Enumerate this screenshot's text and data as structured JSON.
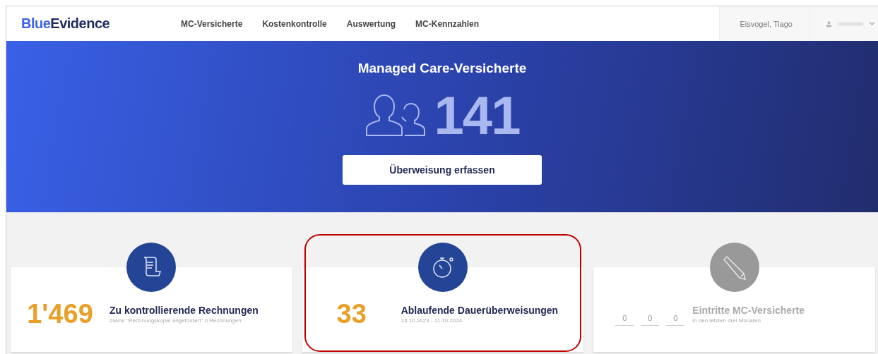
{
  "logo": [
    {
      "text": "Blue",
      "color": "#3d63e6"
    },
    {
      "text": "Evidence",
      "color": "#1f2b5e"
    }
  ],
  "nav": [
    {
      "label": "MC-Versicherte"
    },
    {
      "label": "Kostenkontrolle"
    },
    {
      "label": "Auswertung"
    },
    {
      "label": "MC-Kennzahlen"
    }
  ],
  "user": {
    "name": "Eisvogel, Tiago"
  },
  "hero": {
    "title": "Managed Care-Versicherte",
    "count": "141",
    "button": "Überweisung erfassen"
  },
  "cards": [
    {
      "kind": "number",
      "disabled": false,
      "highlighted": false,
      "value": "1'469",
      "title": "Zu kontrollierende Rechnungen",
      "subtitle": "davon \"Rechnungskopie angefordert\" 0 Rechnungen"
    },
    {
      "kind": "number",
      "disabled": false,
      "highlighted": true,
      "value": "33",
      "title": "Ablaufende Dauerüberweisungen",
      "subtitle": "13.10.2023 - 11.10.2024"
    },
    {
      "kind": "counters",
      "disabled": true,
      "highlighted": false,
      "counters": [
        "0",
        "0",
        "0"
      ],
      "title": "Eintritte MC-Versicherte",
      "subtitle": "in den letzten drei Monaten"
    }
  ]
}
